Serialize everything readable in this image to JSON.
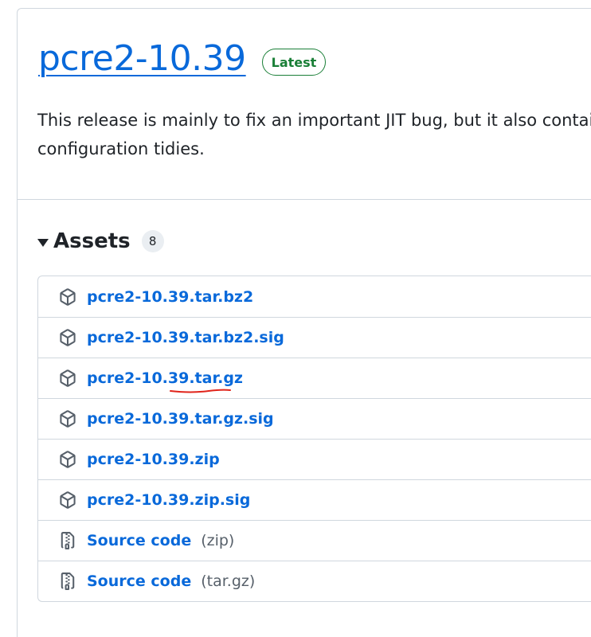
{
  "release": {
    "title": "pcre2-10.39",
    "badge": "Latest",
    "body_line1": "This release is mainly to fix an important JIT bug, but it also contai",
    "body_line2": "configuration tidies."
  },
  "assets": {
    "title": "Assets",
    "count": "8",
    "items": [
      {
        "name": "pcre2-10.39.tar.bz2",
        "icon": "package-icon"
      },
      {
        "name": "pcre2-10.39.tar.bz2.sig",
        "icon": "package-icon"
      },
      {
        "name": "pcre2-10.39.tar.gz",
        "icon": "package-icon"
      },
      {
        "name": "pcre2-10.39.tar.gz.sig",
        "icon": "package-icon"
      },
      {
        "name": "pcre2-10.39.zip",
        "icon": "package-icon"
      },
      {
        "name": "pcre2-10.39.zip.sig",
        "icon": "package-icon"
      },
      {
        "name": "Source code",
        "suffix": "(zip)",
        "icon": "file-zip-icon"
      },
      {
        "name": "Source code",
        "suffix": "(tar.gz)",
        "icon": "file-zip-icon"
      }
    ]
  },
  "colors": {
    "link": "#0969da",
    "badge_green": "#1a7f37",
    "annotation_red": "#e0241b"
  }
}
